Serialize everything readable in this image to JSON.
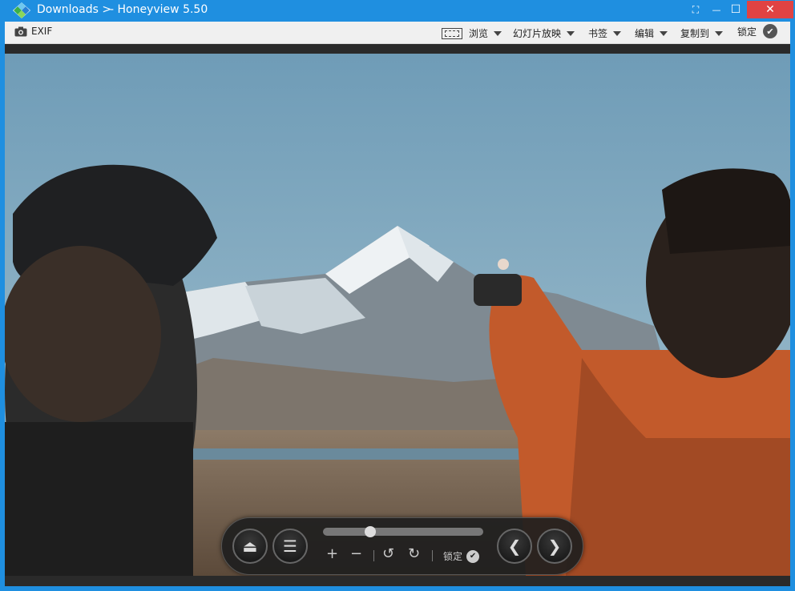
{
  "window": {
    "path": "Downloads",
    "path_arrow": ">",
    "separator": "-",
    "app_name": "Honeyview 5.50",
    "buttons": {
      "fit": "⛶",
      "minimize": "—",
      "maximize": "☐",
      "close": "✕"
    }
  },
  "toolbar": {
    "exif_label": "EXIF",
    "browse_label": "浏览",
    "slideshow_label": "幻灯片放映",
    "bookmark_label": "书签",
    "edit_label": "编辑",
    "copyto_label": "复制到",
    "lock_label": "锁定"
  },
  "image": {
    "subject": "two people pointing at a snow-capped mountain"
  },
  "controls": {
    "eject_icon": "⏏",
    "menu_icon": "☰",
    "zoom_in": "+",
    "zoom_out": "−",
    "rotate_left": "↺",
    "rotate_right": "↻",
    "lock_label": "锁定",
    "prev_icon": "❮",
    "next_icon": "❯",
    "slider_position": 0.28
  },
  "colors": {
    "titlebar": "#1f8fe0",
    "close_button": "#e04343",
    "toolbar": "#f0f0f0"
  }
}
